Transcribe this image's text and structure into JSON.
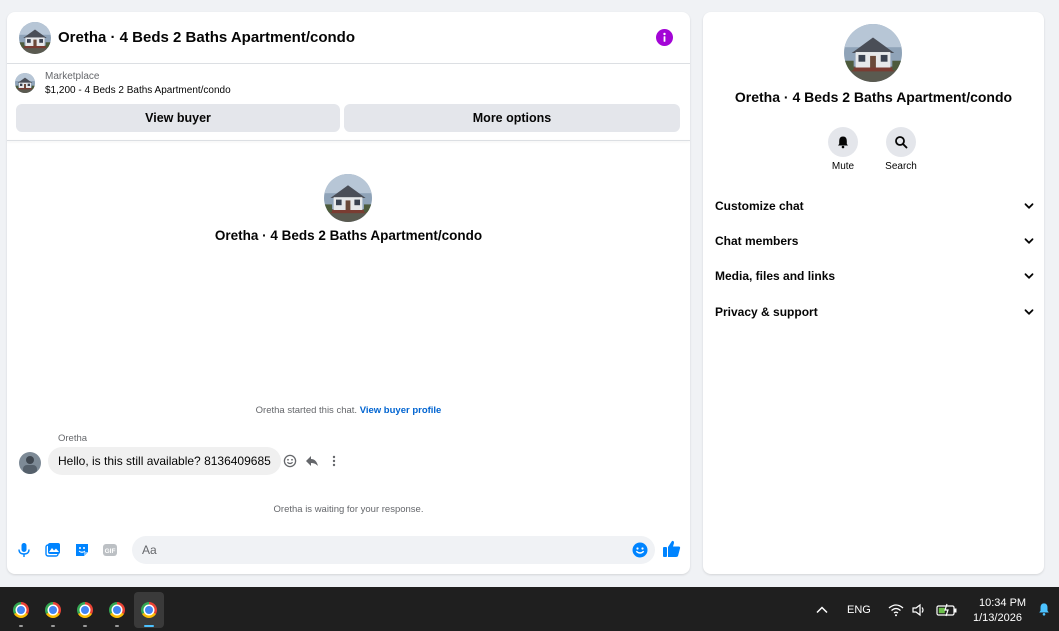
{
  "header": {
    "title": "Oretha · 4 Beds 2 Baths Apartment/condo",
    "info_icon": "info-icon"
  },
  "marketplace": {
    "label": "Marketplace",
    "listing": "$1,200 - 4 Beds 2 Baths Apartment/condo"
  },
  "actions": {
    "view_buyer": "View buyer",
    "more_options": "More options"
  },
  "intro": {
    "title": "Oretha · 4 Beds 2 Baths Apartment/condo"
  },
  "thread": {
    "started_text": "Oretha started this chat.",
    "view_profile_link": "View buyer profile",
    "sender": "Oretha",
    "message": "Hello, is this still available? 8136409685",
    "waiting_text": "Oretha is waiting for your response."
  },
  "composer": {
    "placeholder": "Aa",
    "icons": [
      "microphone-icon",
      "photo-icon",
      "sticker-icon",
      "gif-icon",
      "emoji-icon",
      "like-icon"
    ]
  },
  "side": {
    "title": "Oretha · 4 Beds 2 Baths Apartment/condo",
    "mute_label": "Mute",
    "search_label": "Search",
    "sections": [
      "Customize chat",
      "Chat members",
      "Media, files and links",
      "Privacy & support"
    ]
  },
  "taskbar": {
    "apps": [
      "chrome-icon",
      "chrome-icon",
      "chrome-icon",
      "chrome-icon",
      "chrome-icon"
    ],
    "language": "ENG",
    "time": "10:34 PM",
    "date": "1/13/2026"
  },
  "colors": {
    "accent": "#0084ff",
    "info": "#a305d6",
    "link": "#0064d1"
  }
}
